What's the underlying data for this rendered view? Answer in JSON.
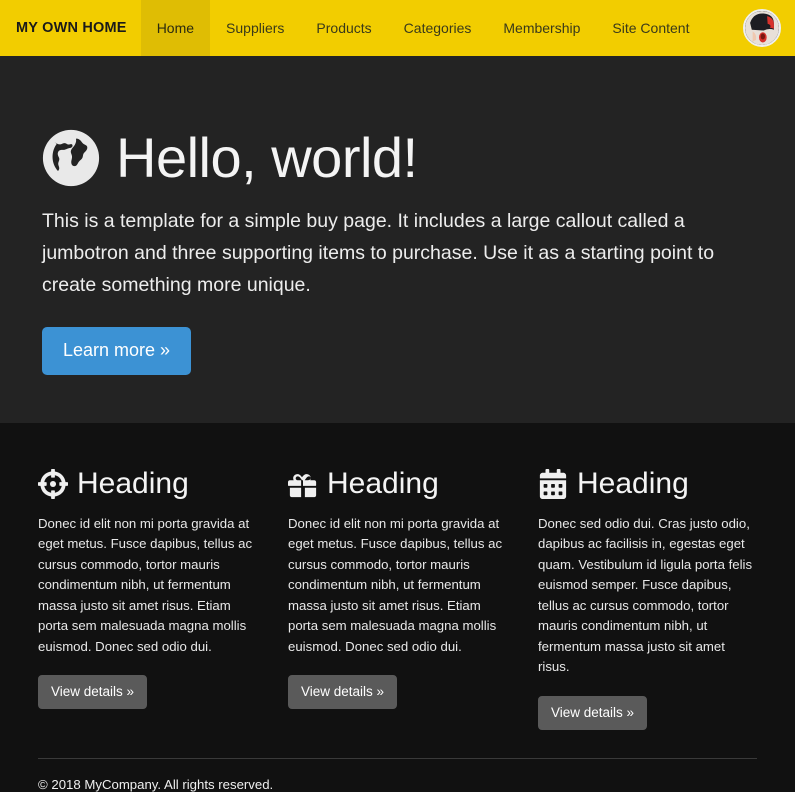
{
  "navbar": {
    "brand": "MY OWN HOME",
    "brand_color": "#f2cd00",
    "active_color": "#dfbd04",
    "items": [
      {
        "label": "Home",
        "active": true
      },
      {
        "label": "Suppliers",
        "active": false
      },
      {
        "label": "Products",
        "active": false
      },
      {
        "label": "Categories",
        "active": false
      },
      {
        "label": "Membership",
        "active": false
      },
      {
        "label": "Site Content",
        "active": false
      }
    ],
    "avatar_icon": "user-avatar-photo"
  },
  "jumbotron": {
    "icon": "globe-icon",
    "title": "Hello, world!",
    "text": "This is a template for a simple buy page. It includes a large callout called a jumbotron and three supporting items to purchase. Use it as a starting point to create something more unique.",
    "button_label": "Learn more »",
    "button_color": "#3c92d4",
    "background": "#232323"
  },
  "features": [
    {
      "icon": "crosshairs-icon",
      "heading": "Heading",
      "text": "Donec id elit non mi porta gravida at eget metus. Fusce dapibus, tellus ac cursus commodo, tortor mauris condimentum nibh, ut fermentum massa justo sit amet risus. Etiam porta sem malesuada magna mollis euismod. Donec sed odio dui.",
      "button_label": "View details »"
    },
    {
      "icon": "gift-icon",
      "heading": "Heading",
      "text": "Donec id elit non mi porta gravida at eget metus. Fusce dapibus, tellus ac cursus commodo, tortor mauris condimentum nibh, ut fermentum massa justo sit amet risus. Etiam porta sem malesuada magna mollis euismod. Donec sed odio dui.",
      "button_label": "View details »"
    },
    {
      "icon": "calendar-icon",
      "heading": "Heading",
      "text": "Donec sed odio dui. Cras justo odio, dapibus ac facilisis in, egestas eget quam. Vestibulum id ligula porta felis euismod semper. Fusce dapibus, tellus ac cursus commodo, tortor mauris condimentum nibh, ut fermentum massa justo sit amet risus.",
      "button_label": "View details »"
    }
  ],
  "footer": {
    "text": "© 2018 MyCompany. All rights reserved."
  }
}
